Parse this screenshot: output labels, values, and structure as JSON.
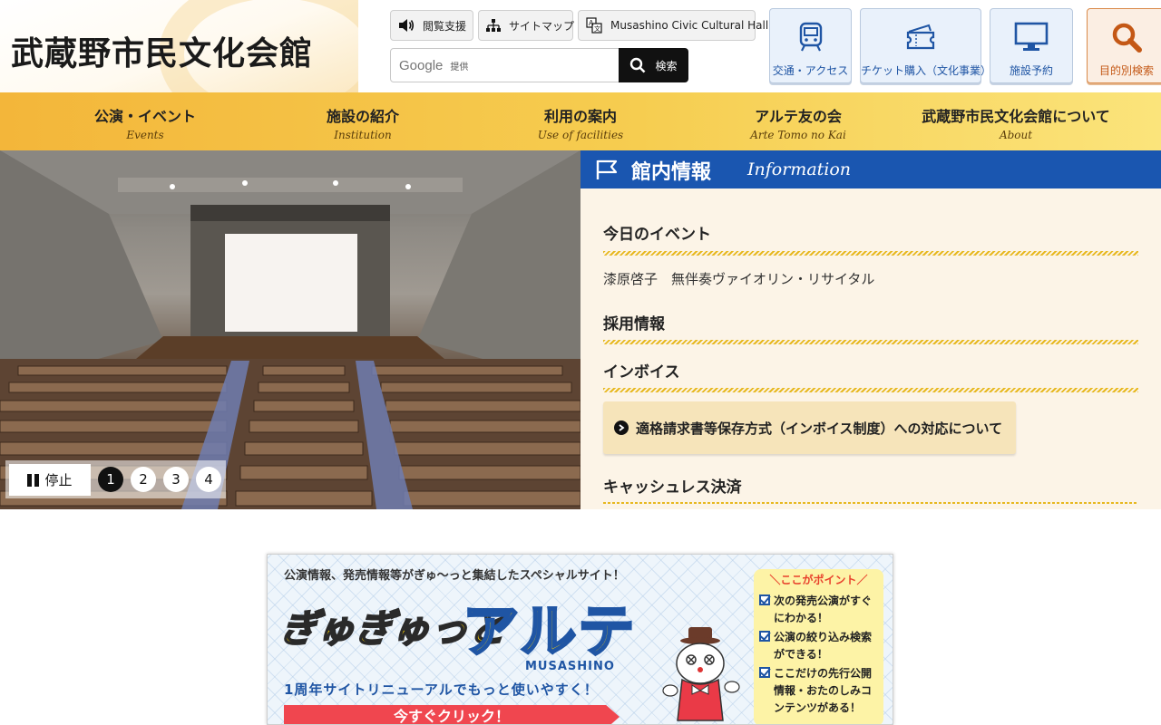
{
  "header": {
    "logo": "武蔵野市民文化会館",
    "utility": [
      {
        "label": "閲覧支援",
        "icon": "speaker-icon"
      },
      {
        "label": "サイトマップ",
        "icon": "sitemap-icon"
      },
      {
        "label": "Musashino Civic Cultural Hall",
        "icon": "translate-icon"
      }
    ],
    "search": {
      "google": "Google",
      "provided": "提供",
      "button": "検索"
    },
    "quick_links": [
      {
        "label": "交通・アクセス",
        "icon": "train-icon"
      },
      {
        "label": "チケット購入（文化事業）",
        "icon": "ticket-icon"
      },
      {
        "label": "施設予約",
        "icon": "monitor-icon"
      },
      {
        "label": "目的別検索",
        "icon": "search-icon"
      }
    ]
  },
  "nav": [
    {
      "jp": "公演・イベント",
      "en": "Events"
    },
    {
      "jp": "施設の紹介",
      "en": "Institution"
    },
    {
      "jp": "利用の案内",
      "en": "Use of facilities"
    },
    {
      "jp": "アルテ友の会",
      "en": "Arte Tomo no Kai"
    },
    {
      "jp": "武蔵野市民文化会館について",
      "en": "About"
    }
  ],
  "slider": {
    "stop_label": "停止",
    "dots": [
      "1",
      "2",
      "3",
      "4"
    ],
    "active": 1
  },
  "info": {
    "title": "館内情報",
    "title_en": "Information",
    "sections": {
      "today": "今日のイベント",
      "event": "漆原啓子　無伴奏ヴァイオリン・リサイタル",
      "recruit": "採用情報",
      "invoice": "インボイス",
      "invoice_link": "適格請求書等保存方式（インボイス制度）への対応について",
      "cashless": "キャッシュレス決済"
    }
  },
  "banner": {
    "top": "公演情報、発売情報等がぎゅ〜っと集結したスペシャルサイト！",
    "gyu": "ぎゅぎゅっと",
    "arte": "アルテ",
    "musashino": "MUSASHINO",
    "renew": "1周年サイトリニューアルでもっと使いやすく！",
    "click": "今すぐクリック！",
    "points_title": "＼ここがポイント／",
    "points": [
      "次の発売公演がすぐにわかる！",
      "公演の絞り込み検索ができる！",
      "ここだけの先行公開情報・おたのしみコンテンツがある！"
    ]
  },
  "colors": {
    "nav_gradient_start": "#f3b63a",
    "nav_gradient_end": "#fbe47b",
    "info_header": "#1a56b0",
    "info_bg": "#fcf4e7",
    "quick_blue": "#1f55a4",
    "quick_orange": "#c45816"
  }
}
